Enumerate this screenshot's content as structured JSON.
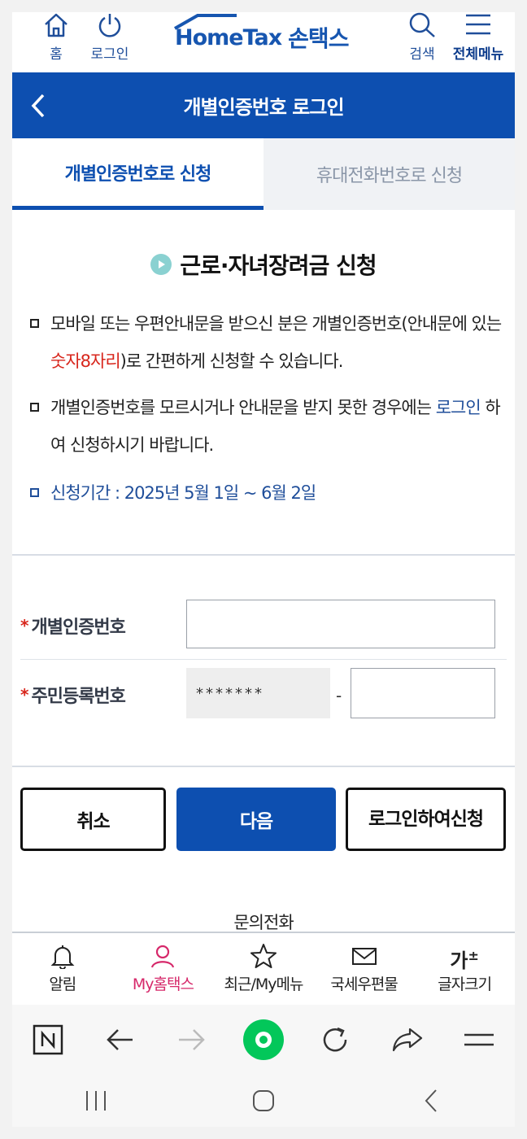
{
  "header": {
    "home_label": "홈",
    "login_label": "로그인",
    "logo_text": "HomeTax",
    "logo_korean": "손택스",
    "search_label": "검색",
    "menu_label": "전체메뉴"
  },
  "title_bar": {
    "title": "개별인증번호 로그인"
  },
  "tabs": [
    {
      "label": "개별인증번호로 신청",
      "active": true
    },
    {
      "label": "휴대전화번호로 신청",
      "active": false
    }
  ],
  "notice": {
    "title": "근로·자녀장려금 신청",
    "bullet1_pre": "모바일 또는 우편안내문을 받으신 분은 개별인증번호(안내문에 있는 ",
    "bullet1_red": "숫자8자리",
    "bullet1_post": ")로 간편하게 신청할 수 있습니다.",
    "bullet2_pre": "개별인증번호를 모르시거나 안내문을 받지 못한 경우에는 ",
    "bullet2_link": "로그인",
    "bullet2_post": " 하여 신청하시기 바랍니다.",
    "bullet3": "신청기간 : 2025년 5월 1일 ~ 6월 2일"
  },
  "form": {
    "required_mark": "*",
    "cert_label": "개별인증번호",
    "cert_value": "",
    "rrn_label": "주민등록번호",
    "rrn_front_value": "*******",
    "rrn_dash": "-",
    "rrn_back_value": ""
  },
  "buttons": {
    "cancel": "취소",
    "next": "다음",
    "login_apply": "로그인하여신청"
  },
  "contact_label": "문의전화",
  "bottom_nav": [
    {
      "label": "알림",
      "icon": "bell-icon",
      "active": false
    },
    {
      "label": "My홈택스",
      "icon": "user-icon",
      "active": true
    },
    {
      "label": "최근/My메뉴",
      "icon": "star-icon",
      "active": false
    },
    {
      "label": "국세우편물",
      "icon": "mail-icon",
      "active": false
    },
    {
      "label": "글자크기",
      "icon": "font-size-icon",
      "active": false
    }
  ],
  "font_icon_text": "가",
  "font_icon_sup": "±",
  "browser_icons": [
    "naver-icon",
    "back-arrow-icon",
    "forward-arrow-icon",
    "home-dot-icon",
    "refresh-icon",
    "share-icon",
    "menu-icon"
  ],
  "colors": {
    "primary": "#0d4fb0",
    "accent_red": "#d8261c",
    "active_pink": "#d6286a",
    "link_blue": "#1f4e9a",
    "naver_green": "#03c75a"
  }
}
